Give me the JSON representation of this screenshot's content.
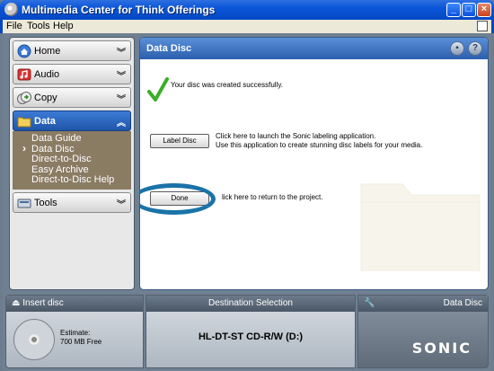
{
  "window": {
    "title": "Multimedia Center for Think Offerings"
  },
  "menu": {
    "file": "File",
    "tools": "Tools",
    "help": "Help"
  },
  "nav": {
    "items": [
      {
        "label": "Home",
        "icon": "home-icon"
      },
      {
        "label": "Audio",
        "icon": "audio-icon"
      },
      {
        "label": "Copy",
        "icon": "copy-icon"
      },
      {
        "label": "Data",
        "icon": "folder-icon",
        "active": true
      },
      {
        "label": "Tools",
        "icon": "tools-icon"
      }
    ],
    "data_subitems": [
      "Data Guide",
      "Data Disc",
      "Direct-to-Disc",
      "Easy Archive",
      "Direct-to-Disc Help"
    ],
    "selected_subitem": "Data Disc"
  },
  "panel": {
    "title": "Data Disc",
    "success_message": "Your disc was created successfully.",
    "label_disc_button": "Label Disc",
    "label_desc_line1": "Click here to launch the Sonic labeling application.",
    "label_desc_line2": "Use this application to create stunning disc labels for your media.",
    "done_button": "Done",
    "done_desc": "lick here to return to the project."
  },
  "bottom": {
    "insert_disc": "Insert disc",
    "estimate_label": "Estimate:",
    "estimate_value": "700 MB Free",
    "destination_title": "Destination Selection",
    "drive": "HL-DT-ST CD-R/W (D:)",
    "mode": "Data Disc",
    "brand": "SONIC"
  },
  "colors": {
    "accent": "#1e55a8",
    "annotation_oval": "#1a73a8",
    "success_check": "#3cae2a"
  }
}
